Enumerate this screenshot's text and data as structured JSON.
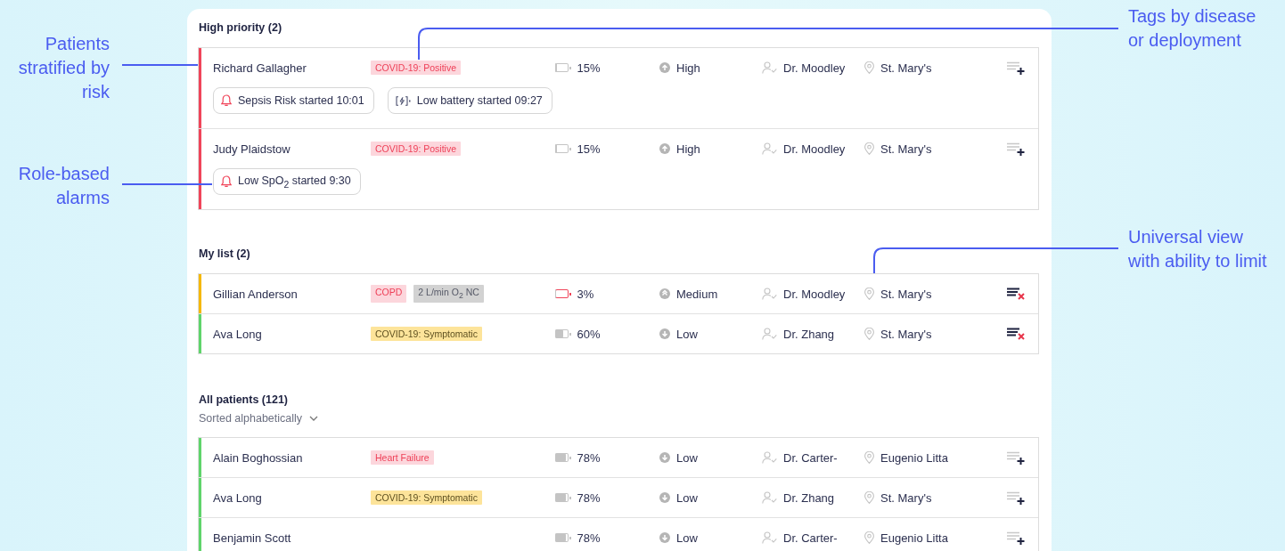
{
  "annotations": [
    {
      "text": "Patients stratified by risk"
    },
    {
      "text": "Role-based alarms"
    },
    {
      "text": "Tags by disease or deployment"
    },
    {
      "text": "Universal view with ability to limit"
    }
  ],
  "sections": [
    {
      "title": "High priority (2)",
      "rows": [
        {
          "name": "Richard Gallagher",
          "color": "#f0455a",
          "tags": [
            {
              "text": "COVID-19: Positive",
              "kind": "alert"
            }
          ],
          "battery": {
            "reading": "15%",
            "level": 0.15,
            "critical": false
          },
          "acuity": {
            "label": "High",
            "kind": "high"
          },
          "doctor": "Dr. Moodley",
          "location": "St. Mary's",
          "kind": "add",
          "alarms": [
            {
              "kind": "clinical",
              "text": "Sepsis Risk started 10:01"
            },
            {
              "kind": "device",
              "text": "Low battery started 09:27"
            }
          ]
        },
        {
          "name": "Judy Plaidstow",
          "color": "#f0455a",
          "tags": [
            {
              "text": "COVID-19: Positive",
              "kind": "alert"
            }
          ],
          "battery": {
            "reading": "15%",
            "level": 0.15,
            "critical": false
          },
          "acuity": {
            "label": "High",
            "kind": "high"
          },
          "doctor": "Dr. Moodley",
          "location": "St. Mary's",
          "kind": "add",
          "alarms": [
            {
              "kind": "clinical",
              "text": "Low SpO$_{2}$ started 9:30"
            }
          ]
        }
      ]
    },
    {
      "title": "My list (2)",
      "rows": [
        {
          "name": "Gillian Anderson",
          "color": "#f5b800",
          "tags": [
            {
              "text": "COPD",
              "kind": "alert"
            },
            {
              "text": "2 L/min O$_{2}$ NC",
              "kind": "neutral"
            }
          ],
          "battery": {
            "reading": "3%",
            "level": 0.03,
            "critical": true
          },
          "acuity": {
            "label": "Medium",
            "kind": "medium"
          },
          "doctor": "Dr. Moodley",
          "location": "St. Mary's",
          "kind": "remove"
        },
        {
          "name": "Ava Long",
          "color": "#5fd46b",
          "tags": [
            {
              "text": "COVID-19: Symptomatic",
              "kind": "warning"
            }
          ],
          "battery": {
            "reading": "60%",
            "level": 0.6,
            "critical": false
          },
          "acuity": {
            "label": "Low",
            "kind": "low"
          },
          "doctor": "Dr. Zhang",
          "location": "St. Mary's",
          "kind": "remove"
        }
      ]
    },
    {
      "title": "All patients (121)",
      "sort": "Sorted alphabetically",
      "rows": [
        {
          "name": "Alain Boghossian",
          "color": "#5fd46b",
          "tags": [
            {
              "text": "Heart Failure",
              "kind": "alert"
            }
          ],
          "battery": {
            "reading": "78%",
            "level": 0.78,
            "critical": false
          },
          "acuity": {
            "label": "Low",
            "kind": "low"
          },
          "doctor": "Dr. Carter-",
          "location": "Eugenio Litta",
          "kind": "add"
        },
        {
          "name": "Ava Long",
          "color": "#5fd46b",
          "tags": [
            {
              "text": "COVID-19: Symptomatic",
              "kind": "warning"
            }
          ],
          "battery": {
            "reading": "78%",
            "level": 0.78,
            "critical": false
          },
          "acuity": {
            "label": "Low",
            "kind": "low"
          },
          "doctor": "Dr. Zhang",
          "location": "St. Mary's",
          "kind": "add"
        },
        {
          "name": "Benjamin Scott",
          "color": "#5fd46b",
          "tags": [],
          "battery": {
            "reading": "78%",
            "level": 0.78,
            "critical": false
          },
          "acuity": {
            "label": "Low",
            "kind": "low"
          },
          "doctor": "Dr. Carter-",
          "location": "Eugenio Litta",
          "kind": "add"
        }
      ]
    }
  ]
}
